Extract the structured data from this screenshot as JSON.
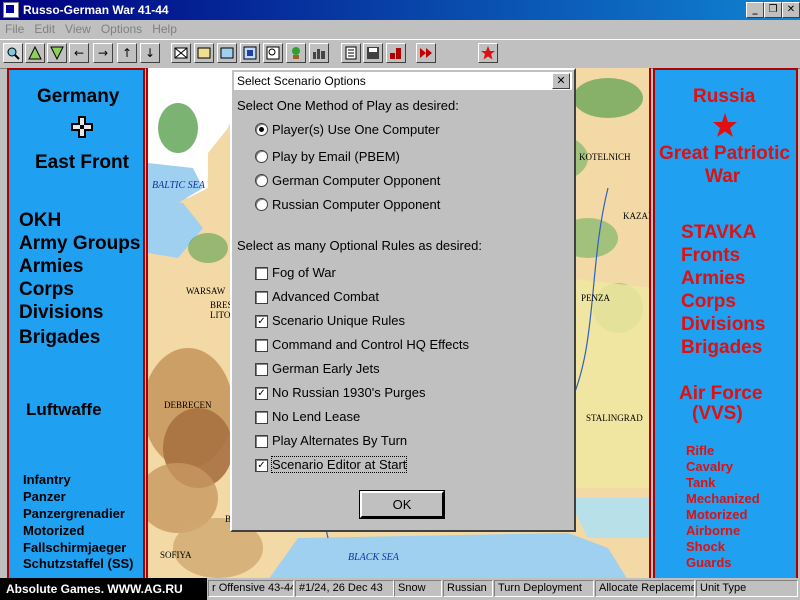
{
  "window": {
    "title": "Russo-German War 41-44"
  },
  "menu": [
    "File",
    "Edit",
    "View",
    "Options",
    "Help"
  ],
  "toolbar_icons": [
    "zoom-icon",
    "triangle-up-icon",
    "triangle-down-icon",
    "arrow-left-icon",
    "arrow-right-icon",
    "arrow-up-icon",
    "arrow-down-icon",
    "box-x-icon",
    "box-icon",
    "box-water-icon",
    "info-icon",
    "find-icon",
    "unit-icon",
    "city-icon",
    "notepad-icon",
    "save-icon",
    "chart-icon",
    "next-turn-icon",
    "star-icon"
  ],
  "left_panel": {
    "line1": "Germany",
    "line2": "East Front",
    "hq": [
      "OKH",
      "Army Groups",
      "Armies",
      "Corps",
      "Divisions",
      "Brigades"
    ],
    "air": "Luftwaffe",
    "types": [
      "Infantry",
      "Panzer",
      "Panzergrenadier",
      "Motorized",
      "Fallschirmjaeger",
      "Schutzstaffel (SS)"
    ]
  },
  "right_panel": {
    "line1": "Russia",
    "line2": "Great Patriotic",
    "line3": "War",
    "hq": [
      "STAVKA",
      "Fronts",
      "Armies",
      "Corps",
      "Divisions",
      "Brigades"
    ],
    "air1": "Air Force",
    "air2": "(VVS)",
    "types": [
      "Rifle",
      "Cavalry",
      "Tank",
      "Mechanized",
      "Motorized",
      "Airborne",
      "Shock",
      "Guards"
    ]
  },
  "map": {
    "cities": [
      "KOTELNICH",
      "KAZAN",
      "WARSAW",
      "BREST",
      "LITOV",
      "PENZA",
      "DEBRECEN",
      "STALINGRAD",
      "SOFIYA",
      "B"
    ],
    "seas": [
      "BALTIC SEA",
      "BLACK SEA"
    ]
  },
  "dialog": {
    "title": "Select Scenario Options",
    "close": "✕",
    "method_heading": "Select One Method of Play as desired:",
    "methods": [
      {
        "label": "Player(s) Use One Computer",
        "selected": true
      },
      {
        "label": "Play by Email (PBEM)",
        "selected": false
      },
      {
        "label": "German Computer Opponent",
        "selected": false
      },
      {
        "label": "Russian Computer Opponent",
        "selected": false
      }
    ],
    "rules_heading": "Select as many Optional Rules as desired:",
    "rules": [
      {
        "label": "Fog of War",
        "checked": false
      },
      {
        "label": "Advanced Combat",
        "checked": false
      },
      {
        "label": "Scenario Unique Rules",
        "checked": true
      },
      {
        "label": "Command and Control HQ Effects",
        "checked": false
      },
      {
        "label": "German Early Jets",
        "checked": false
      },
      {
        "label": "No Russian 1930's Purges",
        "checked": true
      },
      {
        "label": "No Lend Lease",
        "checked": false
      },
      {
        "label": "Play Alternates By Turn",
        "checked": false
      },
      {
        "label": "Scenario Editor at Start",
        "checked": true
      }
    ],
    "ok": "OK"
  },
  "banner": "Absolute Games. WWW.AG.RU",
  "status": [
    "r Offensive 43-44",
    "#1/24, 26 Dec 43",
    "Snow",
    "Russian",
    "Turn Deployment",
    "Allocate Replaceme",
    "Unit Type"
  ],
  "colors": {
    "panel_bg": "#1fa0f0",
    "russian_red": "#e01010",
    "border_red": "#b00000"
  }
}
